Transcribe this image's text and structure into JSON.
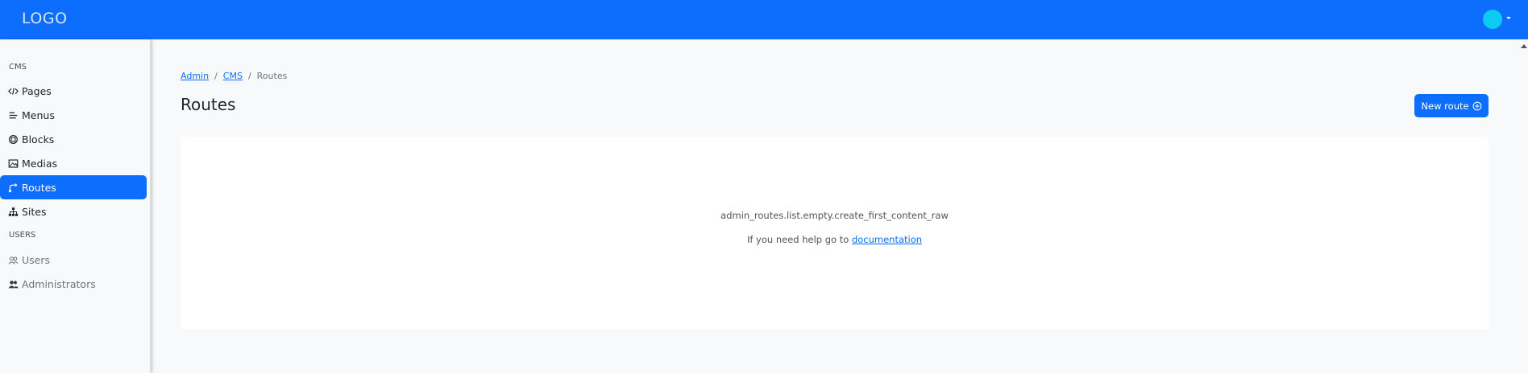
{
  "navbar": {
    "logo": "LOGO",
    "accent": "#0d6efd",
    "avatar_color": "#0dcaf0"
  },
  "sidebar": {
    "sections": [
      {
        "title": "CMS"
      },
      {
        "title": "USERS"
      }
    ],
    "items": [
      {
        "label": "Pages",
        "icon": "code-icon"
      },
      {
        "label": "Menus",
        "icon": "menu-lines-icon"
      },
      {
        "label": "Blocks",
        "icon": "blocks-icon"
      },
      {
        "label": "Medias",
        "icon": "image-icon"
      },
      {
        "label": "Routes",
        "icon": "route-icon",
        "active": true
      },
      {
        "label": "Sites",
        "icon": "sitemap-icon"
      },
      {
        "label": "Users",
        "icon": "users-icon"
      },
      {
        "label": "Administrators",
        "icon": "admins-icon"
      }
    ]
  },
  "breadcrumb": {
    "items": [
      "Admin",
      "CMS",
      "Routes"
    ],
    "separator": "/"
  },
  "page": {
    "title": "Routes",
    "new_button": "New route"
  },
  "empty_state": {
    "message": "admin_routes.list.empty.create_first_content_raw",
    "help_prefix": "If you need help go to",
    "help_link": "documentation"
  }
}
